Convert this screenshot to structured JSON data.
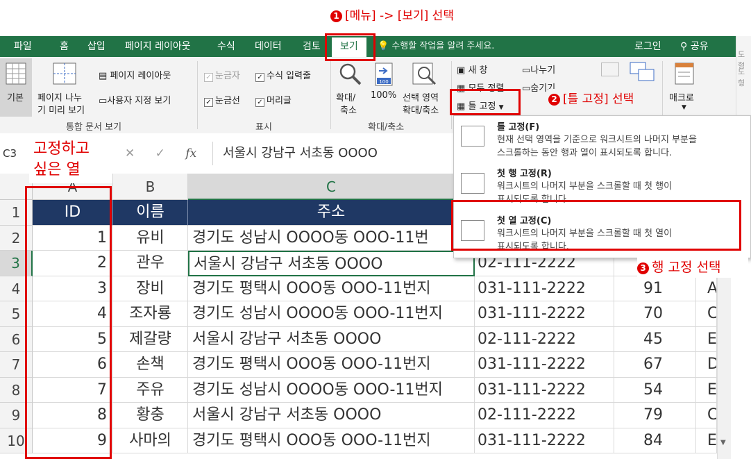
{
  "annotations": {
    "step1": "[메뉴] -> [보기] 선택",
    "step2": "[틀 고정] 선택",
    "step3": "행 고정 선택",
    "frozen_col_note": [
      "고정하고",
      "싶은 열"
    ],
    "badges": [
      "1",
      "2",
      "3"
    ],
    "accent": "#e00000"
  },
  "tabs": [
    "파일",
    "홈",
    "삽입",
    "페이지 레이아웃",
    "수식",
    "데이터",
    "검토",
    "보기"
  ],
  "active_tab": "보기",
  "tell_me": "수행할 작업을 알려 주세요.",
  "login": "로그인",
  "share": "공유",
  "right_strip": [
    "도형",
    "도형"
  ],
  "ribbon": {
    "workbook_views": {
      "normal": "기본",
      "page_break": [
        "페이지 나누",
        "기 미리 보기"
      ],
      "page_layout": "페이지 레이아웃",
      "custom_views": "사용자 지정 보기",
      "label": "통합 문서 보기"
    },
    "show": {
      "ruler": "눈금자",
      "formula_bar": "수식 입력줄",
      "gridlines": "눈금선",
      "headings": "머리글",
      "label": "표시"
    },
    "zoom": {
      "zoom": [
        "확대/",
        "축소"
      ],
      "hundred": "100%",
      "to_selection": [
        "선택 영역",
        "확대/축소"
      ],
      "label": "확대/축소",
      "icon_num": "100"
    },
    "window": {
      "new_window": "새 창",
      "arrange_all": "모두 정렬",
      "freeze_panes": "틀 고정",
      "split": "나누기",
      "hide": "숨기기"
    },
    "macros": "매크로"
  },
  "formula_bar": {
    "name_box": "C3",
    "fx": "fx",
    "content": "서울시 강남구 서초동 OOOO"
  },
  "columns": [
    "A",
    "B",
    "C"
  ],
  "rows": [
    "1",
    "2",
    "3",
    "4",
    "5",
    "6",
    "7",
    "8",
    "9",
    "10"
  ],
  "header_row": [
    "ID",
    "이름",
    "주소"
  ],
  "table": [
    {
      "id": "1",
      "name": "유비",
      "addr": "경기도 성남시 OOOO동 OOO-11번",
      "phone": "",
      "score": "",
      "extra": ""
    },
    {
      "id": "2",
      "name": "관우",
      "addr": "서울시 강남구 서초동 OOOO",
      "phone": "02-111-2222",
      "score": "",
      "extra": ""
    },
    {
      "id": "3",
      "name": "장비",
      "addr": "경기도 평택시 OOO동 OOO-11번지",
      "phone": "031-111-2222",
      "score": "91",
      "extra": "A"
    },
    {
      "id": "4",
      "name": "조자룡",
      "addr": "경기도 성남시 OOOO동 OOO-11번지",
      "phone": "031-111-2222",
      "score": "70",
      "extra": "C"
    },
    {
      "id": "5",
      "name": "제갈량",
      "addr": "서울시 강남구 서초동 OOOO",
      "phone": "02-111-2222",
      "score": "45",
      "extra": "E"
    },
    {
      "id": "6",
      "name": "손책",
      "addr": "경기도 평택시 OOO동 OOO-11번지",
      "phone": "031-111-2222",
      "score": "67",
      "extra": "D"
    },
    {
      "id": "7",
      "name": "주유",
      "addr": "경기도 성남시 OOOO동 OOO-11번지",
      "phone": "031-111-2222",
      "score": "54",
      "extra": "E"
    },
    {
      "id": "8",
      "name": "황충",
      "addr": "서울시 강남구 서초동 OOOO",
      "phone": "02-111-2222",
      "score": "79",
      "extra": "C"
    },
    {
      "id": "9",
      "name": "사마의",
      "addr": "경기도 평택시 OOO동 OOO-11번지",
      "phone": "031-111-2222",
      "score": "84",
      "extra": "E"
    }
  ],
  "freeze_menu": [
    {
      "title": "틀 고정(F)",
      "desc": [
        "현재 선택 영역을 기준으로 워크시트의 나머지 부분을",
        "스크롤하는 동안 행과 열이 표시되도록 합니다."
      ]
    },
    {
      "title": "첫 행 고정(R)",
      "desc": [
        "워크시트의 나머지 부분을 스크롤할 때 첫 행이",
        "표시되도록 합니다."
      ]
    },
    {
      "title": "첫 열 고정(C)",
      "desc": [
        "워크시트의 나머지 부분을 스크롤할 때 첫 열이",
        "표시되도록 합니다."
      ]
    }
  ],
  "colors": {
    "excel_green": "#217346",
    "header_fill": "#1f3864"
  }
}
